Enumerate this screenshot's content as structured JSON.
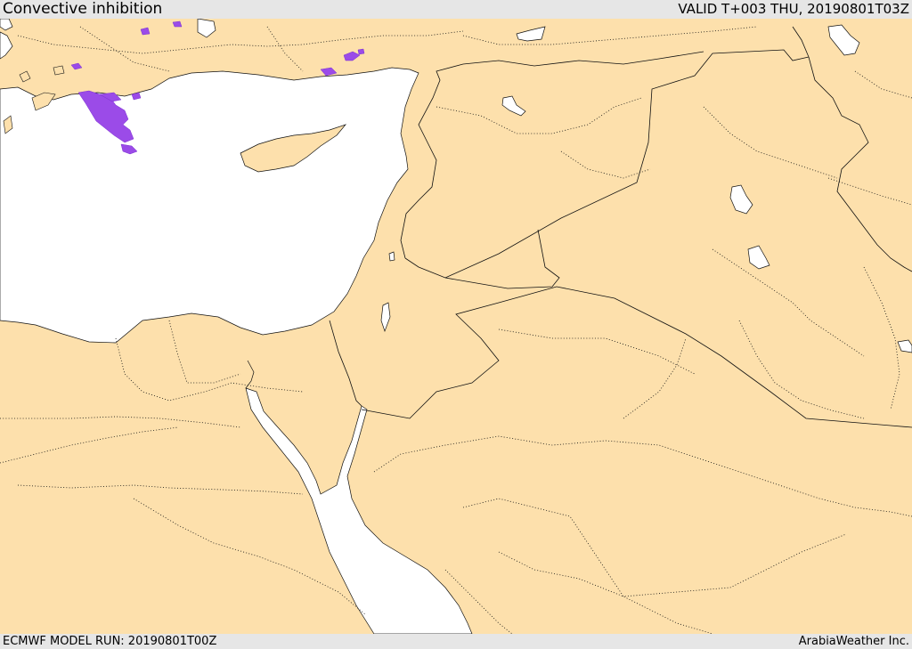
{
  "header": {
    "title": "Convective inhibition",
    "valid": "VALID T+003 THU, 20190801T03Z"
  },
  "footer": {
    "model_run": "ECMWF MODEL RUN: 20190801T00Z",
    "credit": "ArabiaWeather Inc."
  },
  "colors": {
    "land": "#fde0ac",
    "water": "#ffffff",
    "cin_shading": "#9b4be8",
    "borders": "#111111"
  }
}
